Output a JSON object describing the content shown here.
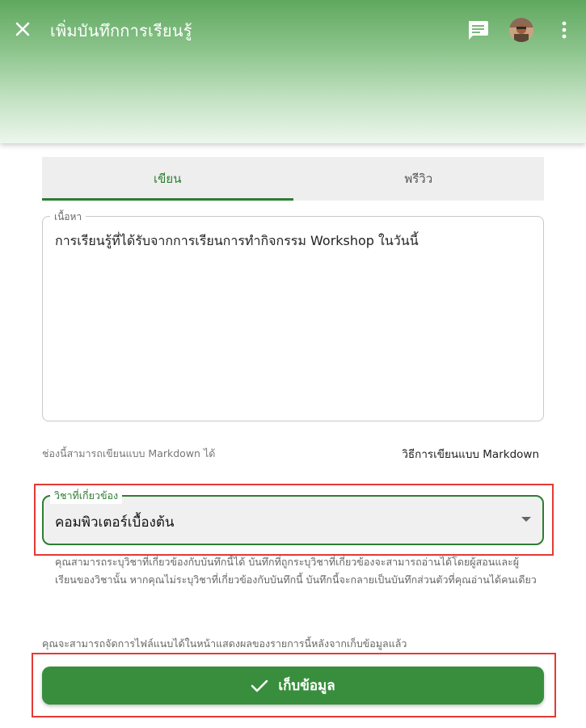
{
  "appbar": {
    "title": "เพิ่มบันทึกการเรียนรู้",
    "icons": [
      "close-icon",
      "chat-icon",
      "avatar",
      "more-vert-icon"
    ]
  },
  "tabs": [
    {
      "label": "เขียน",
      "active": true
    },
    {
      "label": "พรีวิว",
      "active": false
    }
  ],
  "content_field": {
    "label": "เนื้อหา",
    "value": "การเรียนรู้ที่ได้รับจากการเรียนการทำกิจกรรม Workshop ในวันนี้"
  },
  "hint": {
    "left": "ช่องนี้สามารถเขียนแบบ Markdown ได้",
    "right_link": "วิธีการเขียนแบบ Markdown"
  },
  "subject_select": {
    "label": "วิชาที่เกี่ยวข้อง",
    "selected": "คอมพิวเตอร์เบื้องต้น",
    "helper": "คุณสามารถระบุวิชาที่เกี่ยวข้องกับบันทึกนี้ได้ บันทึกที่ถูกระบุวิชาที่เกี่ยวข้องจะสามารถอ่านได้โดยผู้สอนและผู้เรียนของวิชานั้น หากคุณไม่ระบุวิชาที่เกี่ยวข้องกับบันทึกนี้ บันทึกนี้จะกลายเป็นบันทึกส่วนตัวที่คุณอ่านได้คนเดียว"
  },
  "attach_note": "คุณจะสามารถจัดการไฟล์แนบได้ในหน้าแสดงผลของรายการนี้หลังจากเก็บข้อมูลแล้ว",
  "save_button": {
    "label": "เก็บข้อมูล",
    "icon": "check-icon"
  },
  "colors": {
    "primary": "#2e7d32",
    "button": "#388e3c",
    "highlight": "#e53935"
  }
}
